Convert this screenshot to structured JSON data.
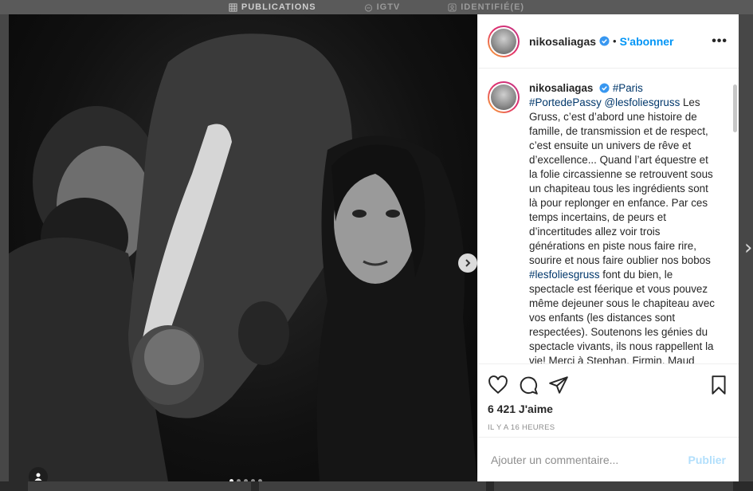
{
  "tabs": [
    {
      "label": "PUBLICATIONS",
      "icon": "grid-icon",
      "active": true
    },
    {
      "label": "IGTV",
      "icon": "igtv-icon",
      "active": false
    },
    {
      "label": "IDENTIFIÉ(E)",
      "icon": "tagged-icon",
      "active": false
    }
  ],
  "post": {
    "username": "nikosaliagas",
    "separator": "•",
    "follow_label": "S'abonner",
    "more_label": "•••",
    "caption": {
      "username": "nikosaliagas",
      "hashtags_top": "#Paris #PortedePassy",
      "mention": "@lesfoliesgruss",
      "text_1": " Les Gruss, c’est d’abord une histoire de famille, de transmission et de respect, c’est ensuite un univers de rêve et d’excellence... Quand l’art équestre et la folie circassienne se retrouvent sous un chapiteau tous les ingrédients sont là pour replonger en enfance. Par ces temps incertains, de peurs et d’incertitudes allez voir trois générations en piste nous faire rire, sourire et nous faire oublier nos bobos ",
      "hashtag_mid": "#lesfoliesgruss",
      "text_2": " font du bien, le spectacle est féerique et vous pouvez même dejeuner sous le chapiteau avec vos enfants (les distances sont respectées). Soutenons les génies du spectacle vivants, ils nous rappellent la vie! Merci à Stephan, Firmin, Maud"
    },
    "likes": "6 421 J'aime",
    "time": "IL Y A 16 HEURES",
    "comment_placeholder": "Ajouter un commentaire...",
    "publish_label": "Publier",
    "carousel": {
      "count": 5,
      "active_index": 0
    }
  },
  "colors": {
    "accent": "#0095f6",
    "publish_disabled": "#b2dffc",
    "text": "#262626",
    "muted": "#8e8e8e"
  }
}
